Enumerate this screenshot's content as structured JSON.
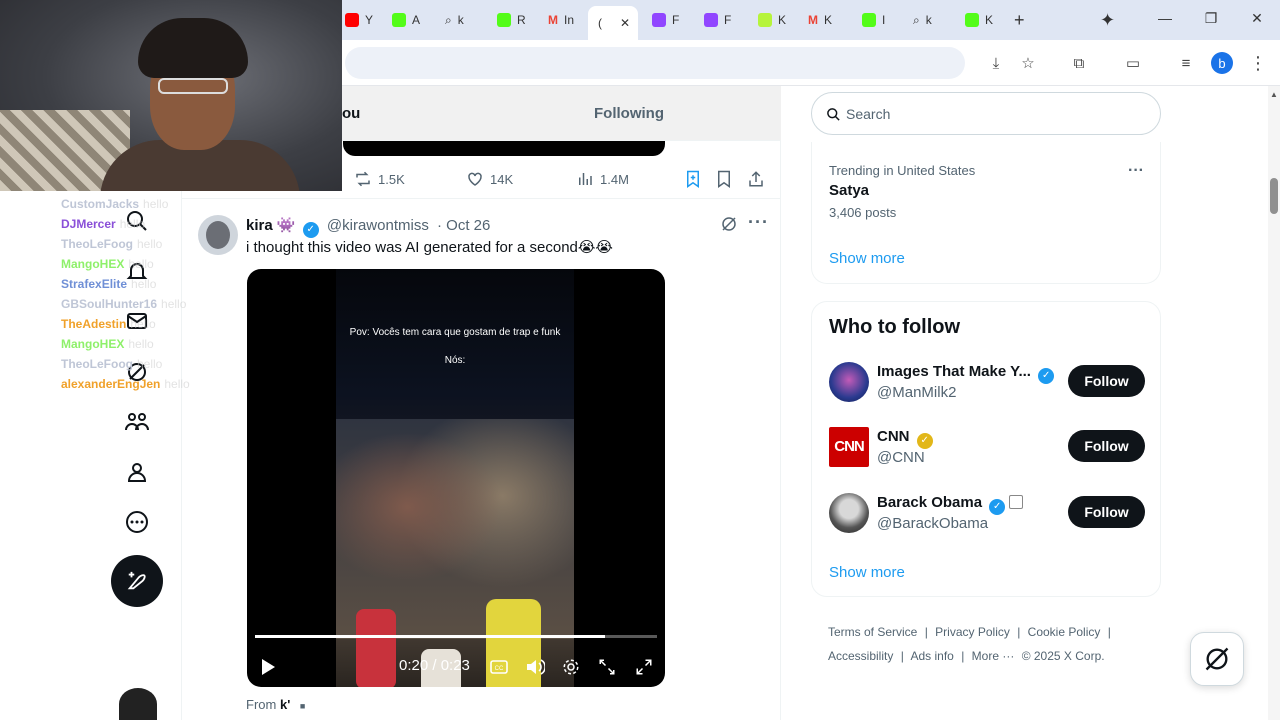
{
  "browser": {
    "tabs": [
      {
        "label": "Y",
        "color": "#ff0000"
      },
      {
        "label": "A",
        "color": "#53fc18"
      },
      {
        "label": "k",
        "color": "#5f6368"
      },
      {
        "label": "R",
        "color": "#53fc18"
      },
      {
        "label": "In",
        "color": "#ea4335"
      },
      {
        "label": "(",
        "color": "#0f1419"
      },
      {
        "label": "F",
        "color": "#9146ff"
      },
      {
        "label": "F",
        "color": "#9146ff"
      },
      {
        "label": "K",
        "color": "#b6f43b"
      },
      {
        "label": "K",
        "color": "#ea4335"
      },
      {
        "label": "I",
        "color": "#53fc18"
      },
      {
        "label": "k",
        "color": "#5f6368"
      },
      {
        "label": "K",
        "color": "#53fc18"
      }
    ],
    "new_tab_symbol": "+",
    "profile_initial": "b"
  },
  "chat": [
    {
      "user": "CustomJacks",
      "color": "#bfc6d6",
      "msg": "hello"
    },
    {
      "user": "DJMercer",
      "color": "#8a4fd8",
      "msg": "hello"
    },
    {
      "user": "TheoLeFoog",
      "color": "#bfc6d6",
      "msg": "hello"
    },
    {
      "user": "MangoHEX",
      "color": "#8ef06a",
      "msg": "hello"
    },
    {
      "user": "StrafexElite",
      "color": "#6f8fd6",
      "msg": "hello"
    },
    {
      "user": "GBSoulHunter16",
      "color": "#bfc6d6",
      "msg": "hello"
    },
    {
      "user": "TheAdestin",
      "color": "#f0a12a",
      "msg": "hello"
    },
    {
      "user": "MangoHEX",
      "color": "#8ef06a",
      "msg": "hello"
    },
    {
      "user": "TheoLeFoog",
      "color": "#bfc6d6",
      "msg": "hello"
    },
    {
      "user": "alexanderEngJen",
      "color": "#f0a12a",
      "msg": "hello"
    }
  ],
  "feed": {
    "tab_for_you": "ou",
    "tab_following": "Following",
    "prev_actions": {
      "reposts": "1.5K",
      "likes": "14K",
      "views": "1.4M"
    }
  },
  "tweet": {
    "name": "kira",
    "name_emoji": "👾",
    "handle": "@kirawontmiss",
    "time": "Oct 26",
    "text": "i thought this video was AI generated for a second😭😭",
    "video": {
      "caption_line1": "Pov: Vocês tem cara que gostam de trap e funk",
      "caption_line2": "Nós:",
      "time_display": "0:20 / 0:23",
      "progress": 0.87
    },
    "from_label": "From",
    "from_name": "k'",
    "from_badge": "■"
  },
  "sidebar": {
    "search_placeholder": "Search",
    "trend": {
      "meta": "Trending in United States",
      "name": "Satya",
      "posts": "3,406 posts",
      "more": "···"
    },
    "show_more": "Show more",
    "who_to_follow": {
      "title": "Who to follow",
      "accounts": [
        {
          "name": "Images That Make Y...",
          "handle": "@ManMilk2",
          "badge": "blue",
          "button": "Follow"
        },
        {
          "name": "CNN",
          "handle": "@CNN",
          "badge": "gold",
          "button": "Follow"
        },
        {
          "name": "Barack Obama",
          "handle": "@BarackObama",
          "badge": "blue",
          "button": "Follow"
        }
      ],
      "show_more": "Show more"
    },
    "footer": [
      "Terms of Service",
      "|",
      "Privacy Policy",
      "|",
      "Cookie Policy",
      "|",
      "Accessibility",
      "|",
      "Ads info",
      "|",
      "More ···",
      "© 2025 X Corp."
    ]
  },
  "colors": {
    "accent": "#1d9bf0",
    "text": "#0f1419",
    "muted": "#536471"
  }
}
